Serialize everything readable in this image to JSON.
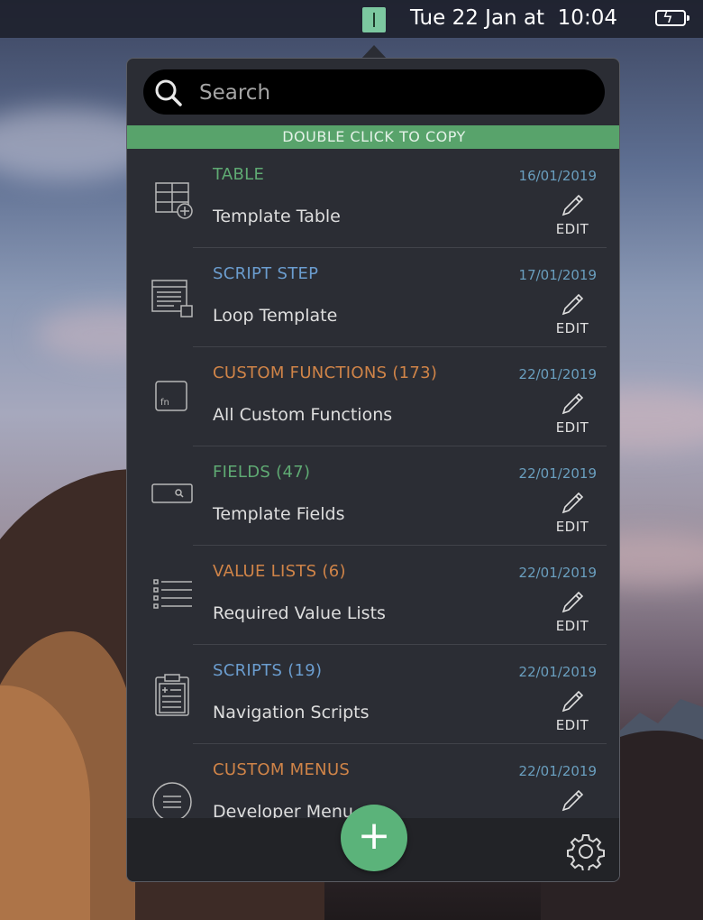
{
  "menubar": {
    "clock": "Tue 22 Jan at  10:04",
    "app_icon": "app-icon",
    "battery_icon": "battery-charging-icon"
  },
  "popover": {
    "search": {
      "placeholder": "Search",
      "icon": "search-icon"
    },
    "banner": "DOUBLE CLICK TO COPY",
    "items": [
      {
        "category": "TABLE",
        "category_color": "#5faa73",
        "date": "16/01/2019",
        "name": "Template Table",
        "icon": "table-add-icon",
        "edit_label": "EDIT"
      },
      {
        "category": "SCRIPT STEP",
        "category_color": "#6b9dcf",
        "date": "17/01/2019",
        "name": "Loop Template",
        "icon": "script-step-icon",
        "edit_label": "EDIT"
      },
      {
        "category": "CUSTOM FUNCTIONS (173)",
        "category_color": "#d08448",
        "date": "22/01/2019",
        "name": "All Custom Functions",
        "icon": "function-icon",
        "edit_label": "EDIT"
      },
      {
        "category": "FIELDS (47)",
        "category_color": "#5faa73",
        "date": "22/01/2019",
        "name": "Template Fields",
        "icon": "field-icon",
        "edit_label": "EDIT"
      },
      {
        "category": "VALUE LISTS (6)",
        "category_color": "#d08448",
        "date": "22/01/2019",
        "name": "Required Value Lists",
        "icon": "value-list-icon",
        "edit_label": "EDIT"
      },
      {
        "category": "SCRIPTS (19)",
        "category_color": "#6b9dcf",
        "date": "22/01/2019",
        "name": "Navigation Scripts",
        "icon": "clipboard-icon",
        "edit_label": "EDIT"
      },
      {
        "category": "CUSTOM MENUS",
        "category_color": "#d08448",
        "date": "22/01/2019",
        "name": "Developer Menu",
        "icon": "menu-icon",
        "edit_label": ""
      }
    ],
    "add_button": "+",
    "settings_icon": "gear-icon"
  }
}
